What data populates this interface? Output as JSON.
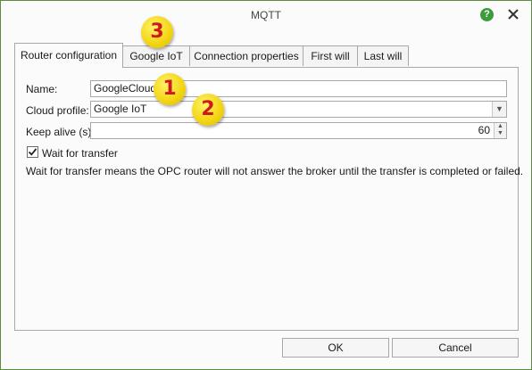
{
  "window": {
    "title": "MQTT",
    "help_label": "?"
  },
  "tabs": [
    "Router configuration",
    "Google IoT",
    "Connection properties",
    "First will",
    "Last will"
  ],
  "form": {
    "name_label": "Name:",
    "name_value": "GoogleCloud",
    "cloud_profile_label": "Cloud profile:",
    "cloud_profile_value": "Google IoT",
    "keep_alive_label": "Keep alive (s):",
    "keep_alive_value": "60",
    "wait_label": "Wait for transfer",
    "wait_checked": true,
    "info_text": "Wait for transfer means the OPC router will not answer the broker until the transfer is completed or failed."
  },
  "buttons": {
    "ok": "OK",
    "cancel": "Cancel"
  },
  "badges": [
    "1",
    "2",
    "3"
  ],
  "colors": {
    "badge": "#f3d410",
    "badge_text": "#d01a1a",
    "help_icon": "#3d9a3d",
    "border_accent": "#5c8e3e"
  }
}
